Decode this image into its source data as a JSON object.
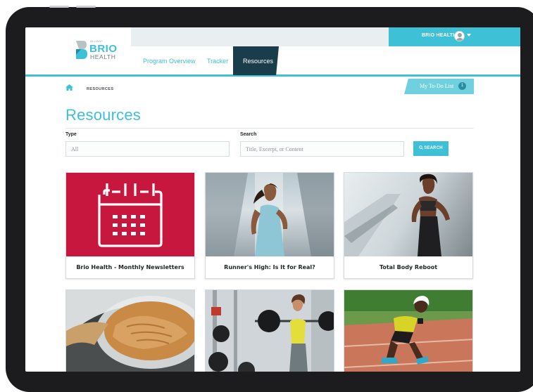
{
  "header": {
    "user_name": "BRIO HEALTH",
    "logo_small": "ALLIANT",
    "logo_brand": "BRIO",
    "logo_sub": "HEALTH"
  },
  "nav": {
    "items": [
      "Program Overview",
      "Tracker",
      "Resources"
    ],
    "active": "Resources"
  },
  "breadcrumb": {
    "current": "RESOURCES"
  },
  "todo": {
    "label": "My To-Do List",
    "count": "1"
  },
  "page": {
    "title": "Resources"
  },
  "filters": {
    "type_label": "Type",
    "type_value": "All",
    "search_label": "Search",
    "search_placeholder": "Title, Excerpt, or Content",
    "search_button": "SEARCH"
  },
  "cards": [
    {
      "title": "Brio Health - Monthly Newsletters",
      "icon": "calendar-icon"
    },
    {
      "title": "Runner's High: Is It for Real?",
      "icon": "runner-photo"
    },
    {
      "title": "Total Body Reboot",
      "icon": "fitness-photo"
    },
    {
      "title": "",
      "icon": "peanut-butter-photo"
    },
    {
      "title": "",
      "icon": "weightlifting-photo"
    },
    {
      "title": "",
      "icon": "track-runner-photo"
    }
  ],
  "colors": {
    "accent": "#3ec0d6",
    "nav_active": "#1a3d4c",
    "newsletter_card": "#c8173e"
  }
}
